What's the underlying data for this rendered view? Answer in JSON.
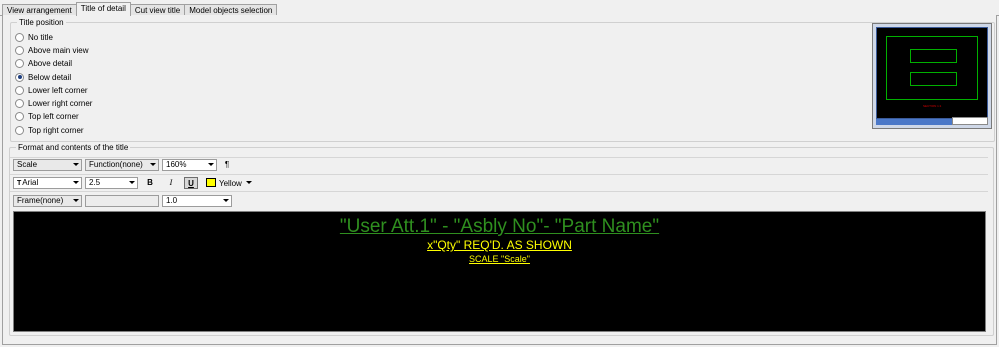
{
  "tabs": [
    {
      "label": "View arrangement"
    },
    {
      "label": "Title of detail"
    },
    {
      "label": "Cut view title"
    },
    {
      "label": "Model objects selection"
    }
  ],
  "title_position": {
    "group_label": "Title position",
    "options": [
      {
        "label": "No title",
        "checked": false
      },
      {
        "label": "Above main view",
        "checked": false
      },
      {
        "label": "Above detail",
        "checked": false
      },
      {
        "label": "Below detail",
        "checked": true
      },
      {
        "label": "Lower left corner",
        "checked": false
      },
      {
        "label": "Lower right corner",
        "checked": false
      },
      {
        "label": "Top left corner",
        "checked": false
      },
      {
        "label": "Top right corner",
        "checked": false
      }
    ]
  },
  "preview": {
    "label": "SECTION 1:1"
  },
  "format": {
    "group_label": "Format and contents of the title",
    "row1": {
      "field": "Scale",
      "function": "Function(none)",
      "size": "160%",
      "pilcrow": "¶"
    },
    "row2": {
      "font": "Arial",
      "height": "2.5",
      "bold": "B",
      "italic": "I",
      "underline": "U",
      "color_name": "Yellow",
      "color_hex": "#ffff00"
    },
    "row3": {
      "frame": "Frame(none)",
      "text": "",
      "value": "1.0"
    }
  },
  "editor": {
    "lines": [
      {
        "text": "\"User Att.1\" - \"Asbly No\"- \"Part Name\"",
        "color": "#2f8f1f"
      },
      {
        "text": "x\"Qty\" REQ'D. AS SHOWN",
        "color": "#ffff00"
      },
      {
        "text": "SCALE \"Scale\"",
        "color": "#ffff00"
      }
    ]
  }
}
